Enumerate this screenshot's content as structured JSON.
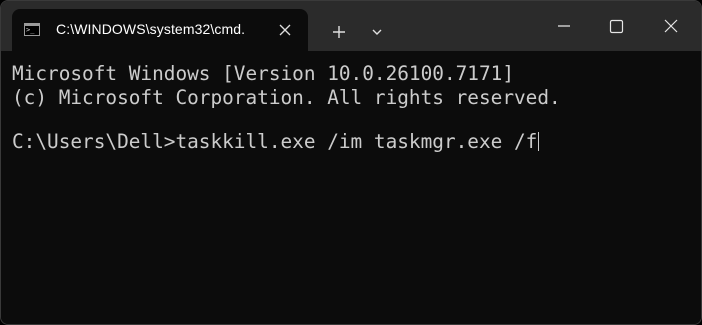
{
  "tab": {
    "title": "C:\\WINDOWS\\system32\\cmd.",
    "icon": "cmd-icon",
    "close_icon": "close-icon"
  },
  "toolbar": {
    "new_tab_icon": "plus-icon",
    "dropdown_icon": "chevron-down-icon"
  },
  "window_controls": {
    "minimize_icon": "minimize-icon",
    "maximize_icon": "maximize-icon",
    "close_icon": "close-icon"
  },
  "terminal": {
    "lines": [
      "Microsoft Windows [Version 10.0.26100.7171]",
      "(c) Microsoft Corporation. All rights reserved.",
      "C:\\Users\\Dell>taskkill.exe /im taskmgr.exe /f"
    ]
  },
  "colors": {
    "titlebar": "#2b2b2b",
    "terminal_bg": "#0c0c0c",
    "terminal_text": "#cccccc"
  }
}
